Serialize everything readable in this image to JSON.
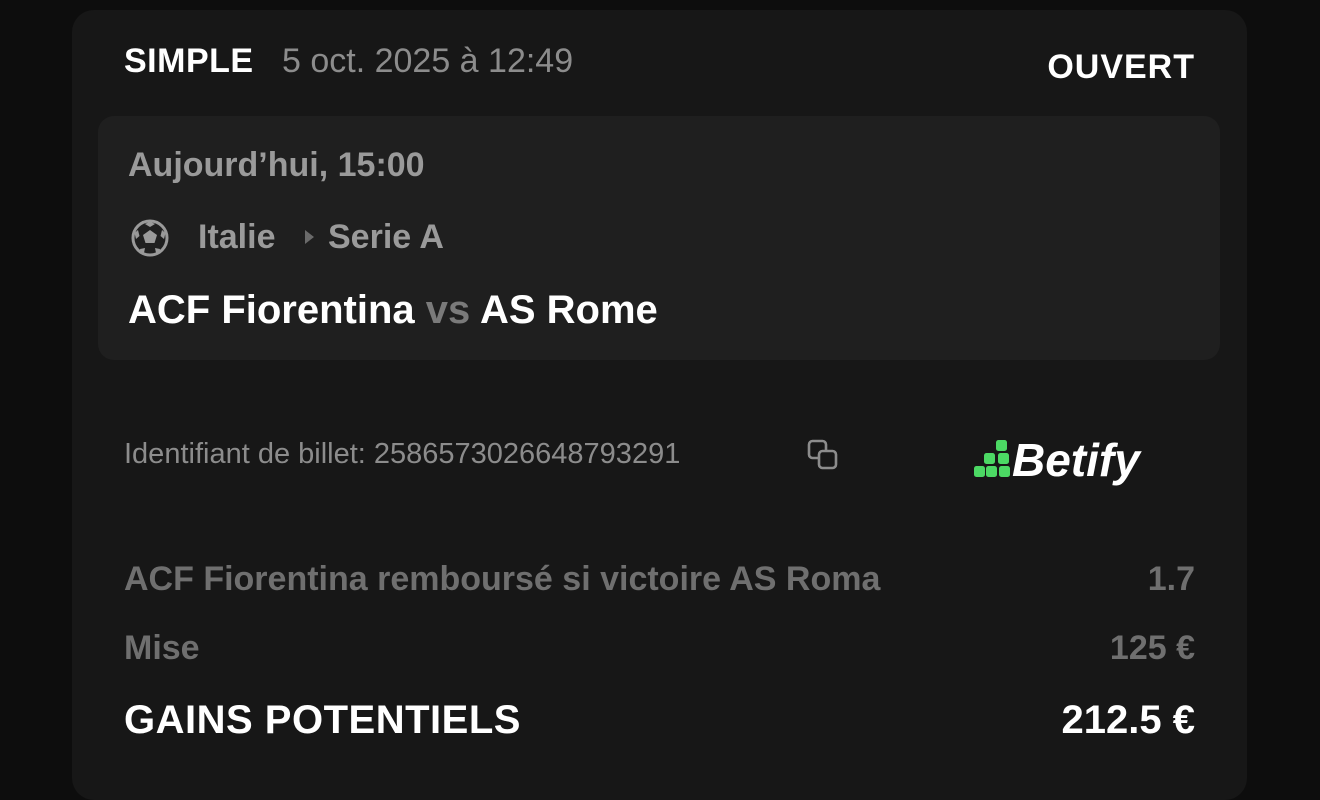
{
  "bet": {
    "type": "SIMPLE",
    "date": "5 oct. 2025 à 12:49",
    "status": "OUVERT"
  },
  "event": {
    "time": "Aujourd’hui, 15:00",
    "sport_icon": "soccer-ball-icon",
    "country": "Italie",
    "league": "Serie A",
    "home_team": "ACF Fiorentina",
    "vs": "vs",
    "away_team": "AS Rome"
  },
  "ticket": {
    "id_label": "Identifiant de billet: 2586573026648793291",
    "copy_icon": "copy-icon"
  },
  "brand": {
    "name": "Betify",
    "accent_color": "#4cd964"
  },
  "summary": {
    "selection": "ACF Fiorentina remboursé si victoire AS Roma",
    "odds": "1.7",
    "stake_label": "Mise",
    "stake_value": "125 €",
    "gains_label": "GAINS POTENTIELS",
    "gains_value": "212.5 €"
  }
}
